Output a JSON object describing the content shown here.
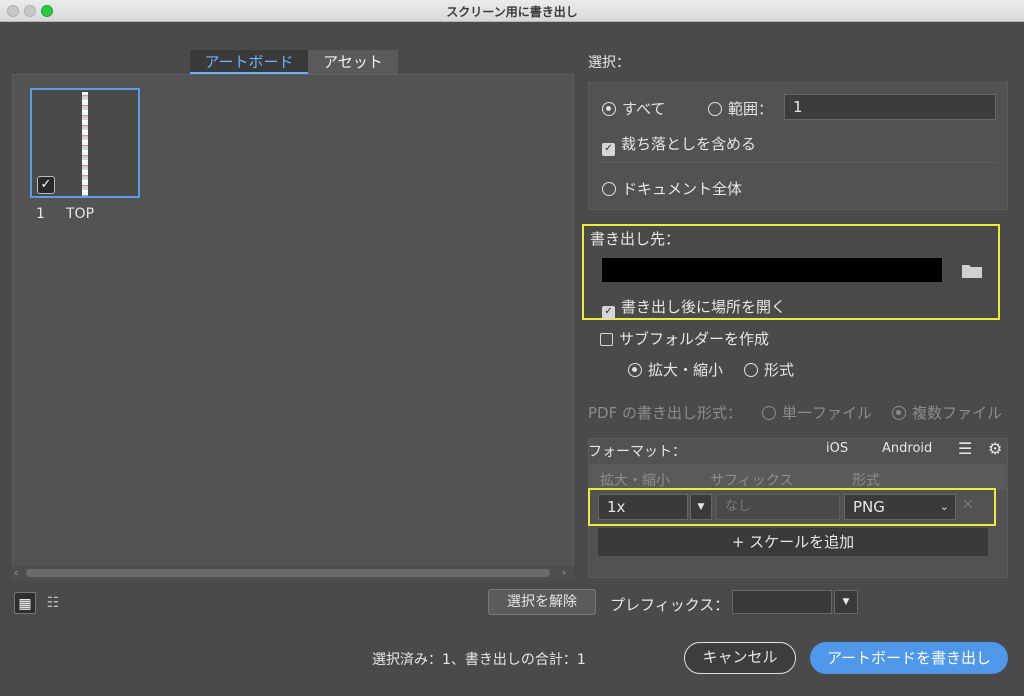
{
  "window": {
    "title": "スクリーン用に書き出し"
  },
  "tabs": [
    {
      "label": "アートボード",
      "active": true
    },
    {
      "label": "アセット",
      "active": false
    }
  ],
  "artboards": [
    {
      "number": "1",
      "name": "TOP",
      "selected": true
    }
  ],
  "selection": {
    "label": "選択：",
    "all_label": "すべて",
    "range_label": "範囲：",
    "range_value": "1",
    "bleed_label": "裁ち落としを含める",
    "whole_doc_label": "ドキュメント全体"
  },
  "export_to": {
    "label": "書き出し先：",
    "open_after_label": "書き出し後に場所を開く",
    "subfolder_label": "サブフォルダーを作成",
    "scale_label": "拡大・縮小",
    "format_label": "形式"
  },
  "pdf": {
    "label": "PDF の書き出し形式：",
    "single_label": "単一ファイル",
    "multi_label": "複数ファイル"
  },
  "formats": {
    "label": "フォーマット：",
    "ios_label": "iOS",
    "android_label": "Android",
    "col_scale": "拡大・縮小",
    "col_suffix": "サフィックス",
    "col_format": "形式",
    "rows": [
      {
        "scale": "1x",
        "suffix_placeholder": "なし",
        "format": "PNG"
      }
    ],
    "add_scale_label": "+ スケールを追加"
  },
  "footer": {
    "deselect_label": "選択を解除",
    "prefix_label": "プレフィックス：",
    "summary": "選択済み：1、書き出しの合計：1",
    "cancel_label": "キャンセル",
    "export_label": "アートボードを書き出し"
  },
  "colors": {
    "accent": "#4f97e8",
    "highlight": "#ecec3a"
  }
}
